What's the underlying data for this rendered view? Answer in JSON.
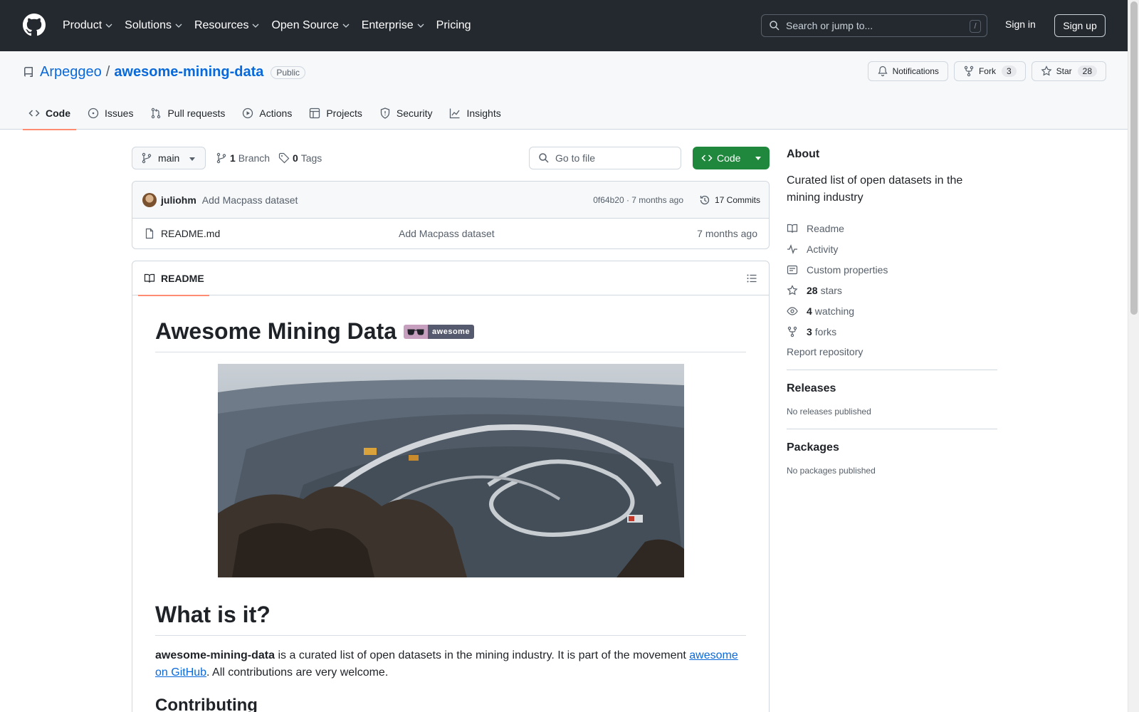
{
  "header": {
    "nav": [
      {
        "label": "Product",
        "has_menu": true
      },
      {
        "label": "Solutions",
        "has_menu": true
      },
      {
        "label": "Resources",
        "has_menu": true
      },
      {
        "label": "Open Source",
        "has_menu": true
      },
      {
        "label": "Enterprise",
        "has_menu": true
      },
      {
        "label": "Pricing",
        "has_menu": false
      }
    ],
    "search_placeholder": "Search or jump to...",
    "search_shortcut": "/",
    "signin_label": "Sign in",
    "signup_label": "Sign up"
  },
  "repo": {
    "owner": "Arpeggeo",
    "separator": "/",
    "name": "awesome-mining-data",
    "visibility": "Public",
    "notifications_label": "Notifications",
    "fork_label": "Fork",
    "fork_count": "3",
    "star_label": "Star",
    "star_count": "28",
    "tabs": [
      {
        "label": "Code",
        "icon": "code-icon",
        "active": true
      },
      {
        "label": "Issues",
        "icon": "issue-opened-icon",
        "active": false
      },
      {
        "label": "Pull requests",
        "icon": "git-pull-request-icon",
        "active": false
      },
      {
        "label": "Actions",
        "icon": "play-icon",
        "active": false
      },
      {
        "label": "Projects",
        "icon": "table-icon",
        "active": false
      },
      {
        "label": "Security",
        "icon": "shield-icon",
        "active": false
      },
      {
        "label": "Insights",
        "icon": "graph-icon",
        "active": false
      }
    ]
  },
  "toolbar": {
    "branch": "main",
    "branch_count": "1",
    "branch_label": "Branch",
    "tag_count": "0",
    "tag_label": "Tags",
    "goto_placeholder": "Go to file",
    "code_button": "Code"
  },
  "latest_commit": {
    "author": "juliohm",
    "message": "Add Macpass dataset",
    "hash_time": "0f64b20 · 7 months ago",
    "commits_label": "17 Commits"
  },
  "files": [
    {
      "name": "README.md",
      "message": "Add Macpass dataset",
      "time": "7 months ago",
      "icon": "file-icon"
    }
  ],
  "readme": {
    "tab_label": "README",
    "title": "Awesome Mining Data",
    "badge_text": "awesome",
    "section1_title": "What is it?",
    "p1_bold": "awesome-mining-data",
    "p1_text": " is a curated list of open datasets in the mining industry. It is part of the movement ",
    "p1_link": "awesome on GitHub",
    "p1_tail": ". All contributions are very welcome.",
    "section2_title": "Contributing"
  },
  "about": {
    "title": "About",
    "description": "Curated list of open datasets in the mining industry",
    "links": [
      {
        "icon": "book-icon",
        "count": "",
        "label": "Readme"
      },
      {
        "icon": "pulse-icon",
        "count": "",
        "label": "Activity"
      },
      {
        "icon": "note-icon",
        "count": "",
        "label": "Custom properties"
      },
      {
        "icon": "star-icon",
        "count": "28",
        "label": "stars"
      },
      {
        "icon": "eye-icon",
        "count": "4",
        "label": "watching"
      },
      {
        "icon": "repo-forked-icon",
        "count": "3",
        "label": "forks"
      }
    ],
    "report_label": "Report repository"
  },
  "releases": {
    "title": "Releases",
    "empty": "No releases published"
  },
  "packages": {
    "title": "Packages",
    "empty": "No packages published"
  },
  "colors": {
    "header_bg": "#24292f",
    "link": "#0969da",
    "primary_button": "#1f883d",
    "tab_underline": "#fd8c73"
  }
}
